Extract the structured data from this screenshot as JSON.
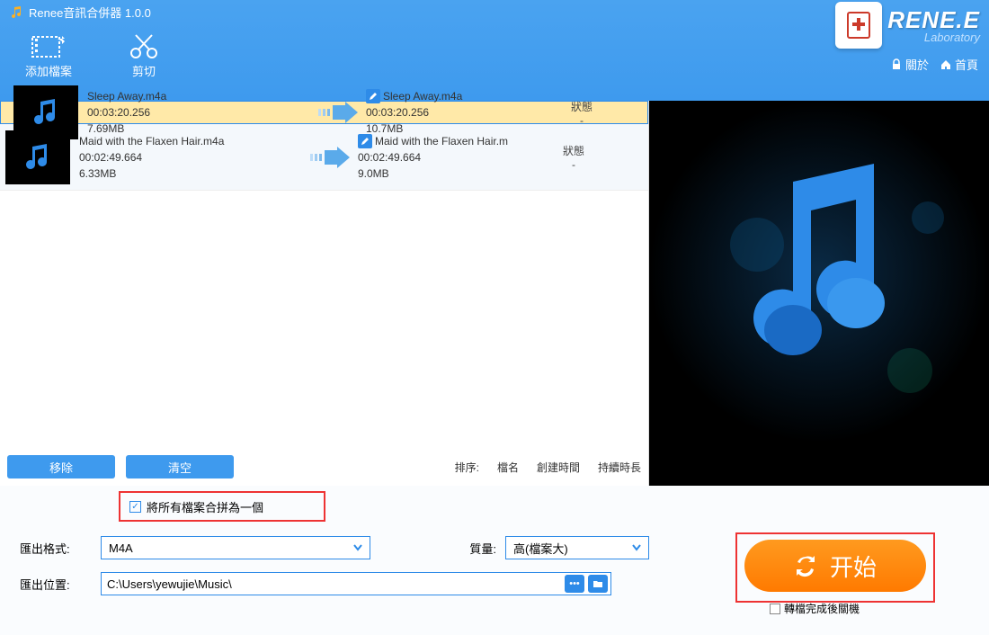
{
  "app": {
    "title": "Renee音訊合併器 1.0.0"
  },
  "brand": {
    "name": "RENE.E",
    "sub": "Laboratory",
    "about": "關於",
    "home": "首頁"
  },
  "toolbar": {
    "add": "添加檔案",
    "cut": "剪切"
  },
  "rows": [
    {
      "name": "Sleep Away.m4a",
      "dur": "00:03:20.256",
      "size": "7.69MB",
      "out_name": "Sleep Away.m4a",
      "out_dur": "00:03:20.256",
      "out_size": "10.7MB",
      "state_label": "狀態",
      "state_val": "-"
    },
    {
      "name": "Maid with the Flaxen Hair.m4a",
      "dur": "00:02:49.664",
      "size": "6.33MB",
      "out_name": "Maid with the Flaxen Hair.m",
      "out_dur": "00:02:49.664",
      "out_size": "9.0MB",
      "state_label": "狀態",
      "state_val": "-"
    }
  ],
  "buttons": {
    "remove": "移除",
    "clear": "清空"
  },
  "sort": {
    "label": "排序:",
    "name": "檔名",
    "ctime": "創建時間",
    "dur": "持續時長"
  },
  "merge": {
    "checkbox": "將所有檔案合拼為一個"
  },
  "form": {
    "format_label": "匯出格式:",
    "format_value": "M4A",
    "quality_label": "質量:",
    "quality_value": "高(檔案大)",
    "path_label": "匯出位置:",
    "path_value": "C:\\Users\\yewujie\\Music\\"
  },
  "start": "开始",
  "shutdown": "轉檔完成後關機",
  "colors": {
    "primary": "#3e9aee",
    "accent": "#ff7a00",
    "highlight": "#e33"
  }
}
